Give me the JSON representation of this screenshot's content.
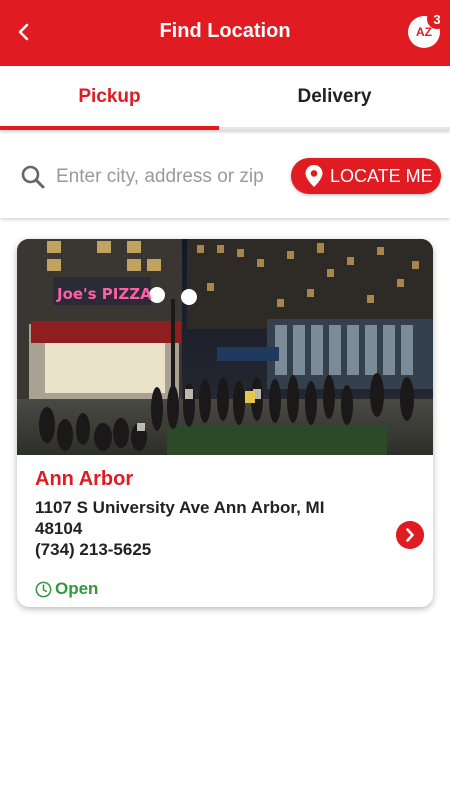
{
  "header": {
    "title": "Find Location",
    "avatar_initials": "AZ",
    "badge_count": "3",
    "back_icon": "chevron-left-icon",
    "brand_color": "#e11b22"
  },
  "tabs": [
    {
      "label": "Pickup",
      "active": true
    },
    {
      "label": "Delivery",
      "active": false
    }
  ],
  "search": {
    "placeholder": "Enter city, address or zip",
    "value": "",
    "icon": "search-icon",
    "locate_label": "LOCATE ME",
    "locate_icon": "map-pin-icon"
  },
  "locations": [
    {
      "name": "Ann Arbor",
      "address": "1107 S University Ave Ann Arbor, MI 48104",
      "phone": "(734) 213-5625",
      "status": "Open",
      "status_color": "#2e9a3b",
      "photo_sign": "Joe's PIZZA"
    }
  ]
}
